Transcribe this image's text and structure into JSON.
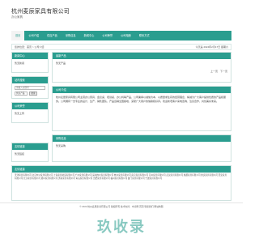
{
  "header": {
    "title": "杭州麦辰家具有限公司",
    "subtitle": "办公家具"
  },
  "nav": {
    "items": [
      {
        "label": "首页",
        "active": true
      },
      {
        "label": "公司介绍",
        "active": false
      },
      {
        "label": "供应产品",
        "active": false
      },
      {
        "label": "采购信息",
        "active": false
      },
      {
        "label": "新闻中心",
        "active": false
      },
      {
        "label": "公司荣誉",
        "active": false
      },
      {
        "label": "公司相册",
        "active": false
      },
      {
        "label": "联系方式",
        "active": false
      }
    ]
  },
  "breadcrumb": {
    "text": "您的位置：首页 > 公司介绍",
    "date": "今天是 2024年2月17日 星期六"
  },
  "sidebar": {
    "news": {
      "title": "新闻中心",
      "items": [
        "暂无新闻"
      ]
    },
    "search": {
      "title": "站内搜索",
      "keyword_placeholder": "请输入关键词",
      "select_label": "供应产品",
      "search_button": "搜索"
    },
    "honor": {
      "title": "公司荣誉",
      "items": [
        "暂无上传"
      ]
    },
    "links": {
      "title": "友情链接",
      "items": [
        "暂无链接"
      ]
    }
  },
  "main": {
    "products": {
      "title": "最新产品",
      "empty_text": "暂无产品"
    },
    "pager": {
      "prev": "上一页",
      "next": "下一页"
    },
    "about": {
      "title": "公司介绍",
      "body": "杭州麦辰家具有限公司主营办公家具、会议桌、培训桌、办公椅等产品，公司秉承以诚信为本、以质量求生存的经营理念，竭诚为广大客户提供优质的产品和服务。公司拥有一支专业的设计、生产、销售团队，产品远销全国各地，深受广大用户的信赖和好评。欢迎新老客户来电咨询、洽谈合作，共创美好未来。"
    },
    "purchase": {
      "title": "采购信息",
      "empty_text": "暂无采购"
    }
  },
  "friend_links": {
    "title": "友情链接",
    "text": "天津家具有限公司 北京办公家具有限公司 上海家具制造有限公司 广州家具有限公司 深圳办公家具有限公司 杭州家具有限公司 南京家具有限公司 苏州家具有限公司 武汉家具有限公司 成都家具有限公司 重庆家具有限公司 西安家具有限公司 长沙家具有限公司 郑州家具有限公司 济南家具有限公司 青岛家具有限公司 合肥家具有限公司 福州家具有限公司 厦门家具有限公司 宁波家具有限公司"
  },
  "footer": {
    "line1": "© 2022 杭州麦辰家具有限公司  版权所有  技术支持：中企网  首页  联系我们  网站地图"
  },
  "watermark": "玖收录",
  "colors": {
    "accent": "#2a9d8f"
  }
}
